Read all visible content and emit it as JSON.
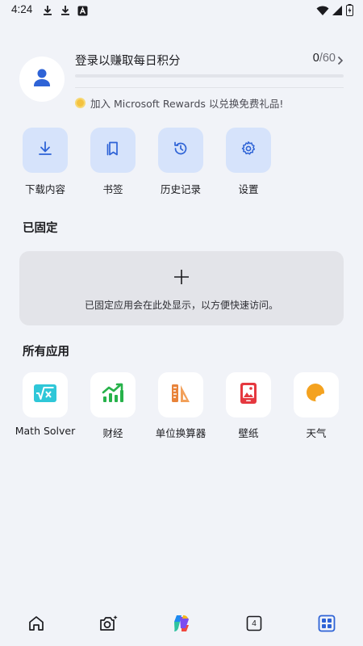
{
  "status_bar": {
    "time": "4:24"
  },
  "rewards": {
    "title": "登录以赚取每日积分",
    "points": "0",
    "total": "/60",
    "progress": 0,
    "join_text": "加入 Microsoft Rewards 以兑换免费礼品!"
  },
  "quick_actions": [
    {
      "label": "下载内容",
      "icon": "download-icon"
    },
    {
      "label": "书签",
      "icon": "bookmark-icon"
    },
    {
      "label": "历史记录",
      "icon": "history-icon"
    },
    {
      "label": "设置",
      "icon": "settings-gear-icon"
    }
  ],
  "pinned": {
    "title": "已固定",
    "empty_text": "已固定应用会在此处显示，以方便快速访问。"
  },
  "apps": {
    "title": "所有应用",
    "items": [
      {
        "label": "Math Solver",
        "icon": "math-solver-icon"
      },
      {
        "label": "财经",
        "icon": "finance-icon"
      },
      {
        "label": "单位换算器",
        "icon": "unit-converter-icon"
      },
      {
        "label": "壁纸",
        "icon": "wallpaper-icon"
      },
      {
        "label": "天气",
        "icon": "weather-icon"
      }
    ]
  },
  "bottom_nav": {
    "tab_count": "4"
  },
  "colors": {
    "background": "#f1f3f8",
    "accent": "#3b6fe0",
    "tile_blue": "#d6e3fb",
    "pinned_box": "#e3e4e9"
  }
}
